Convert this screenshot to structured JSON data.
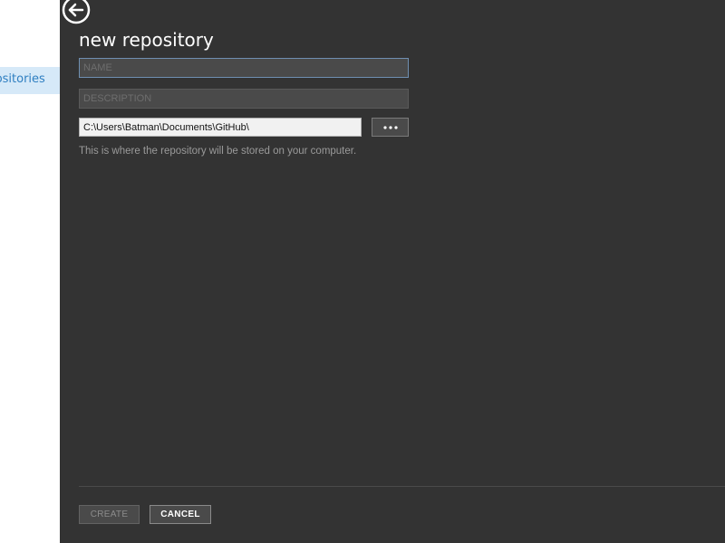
{
  "sidebar": {
    "selected_item_label": "Repositories"
  },
  "dialog": {
    "title": "new repository",
    "name_placeholder": "NAME",
    "description_placeholder": "DESCRIPTION",
    "path_value": "C:\\Users\\Batman\\Documents\\GitHub\\",
    "browse_label": "•••",
    "path_hint": "This is where the repository will be stored on your computer.",
    "create_label": "CREATE",
    "cancel_label": "CANCEL"
  },
  "icons": {
    "back": "back-arrow-circle-icon",
    "browse": "ellipsis-icon"
  },
  "colors": {
    "panel_bg": "#333333",
    "field_bg": "#4a4a4a",
    "selected_item_bg": "#d6e9f8",
    "selected_item_text": "#2f7fc1",
    "focus_border": "#6f8fb1"
  }
}
